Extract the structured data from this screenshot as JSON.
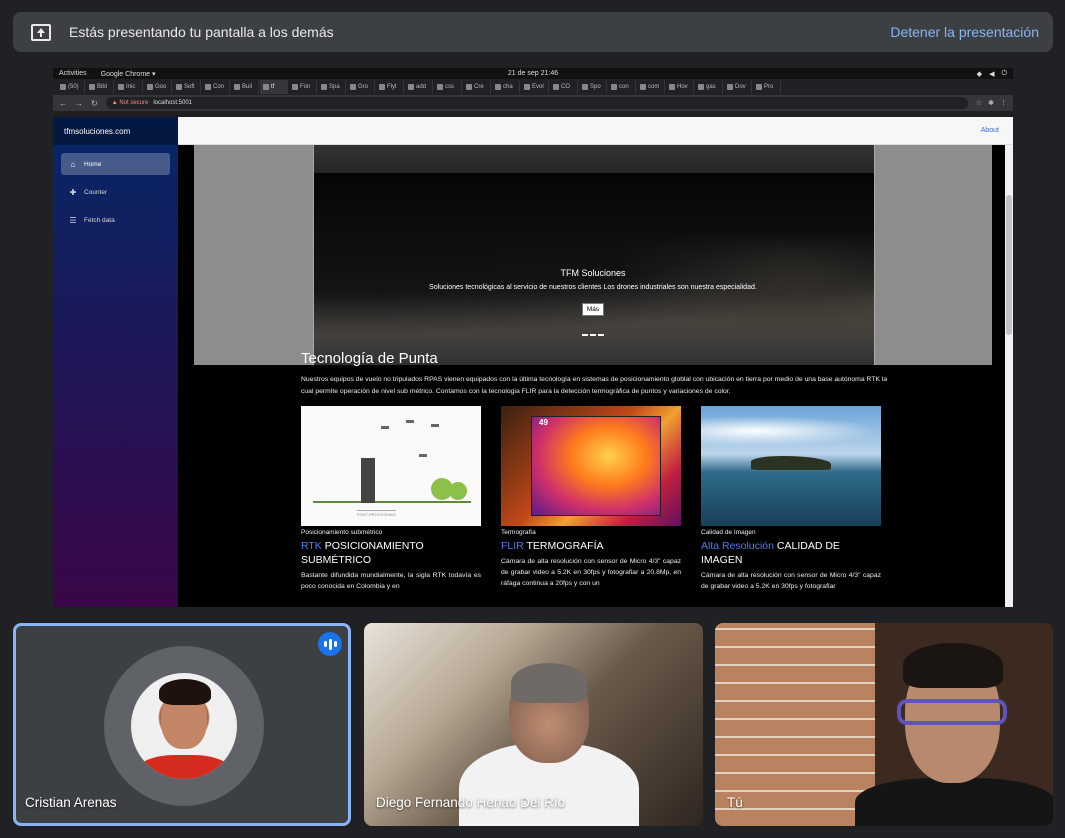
{
  "present_bar": {
    "message": "Estás presentando tu pantalla a los demás",
    "stop_label": "Detener la presentación"
  },
  "desktop": {
    "activities": "Activities",
    "app_menu": "Google Chrome ▾",
    "clock": "21 de sep  21:46"
  },
  "browser": {
    "tabs": [
      {
        "label": "(50)"
      },
      {
        "label": "Bibl"
      },
      {
        "label": "Inic"
      },
      {
        "label": "Goo"
      },
      {
        "label": "Soft"
      },
      {
        "label": "Con"
      },
      {
        "label": "Buil"
      },
      {
        "label": "tf"
      },
      {
        "label": "Fon"
      },
      {
        "label": "Spa"
      },
      {
        "label": "Gro"
      },
      {
        "label": "Flyt"
      },
      {
        "label": "add"
      },
      {
        "label": "css"
      },
      {
        "label": "Cre"
      },
      {
        "label": "cha"
      },
      {
        "label": "Evol"
      },
      {
        "label": "CO"
      },
      {
        "label": "Spo"
      },
      {
        "label": "con"
      },
      {
        "label": "com"
      },
      {
        "label": "Hov"
      },
      {
        "label": "gas"
      },
      {
        "label": "Dov"
      },
      {
        "label": "Pro"
      }
    ],
    "security_label": "Not secure",
    "url": "localhost:5001"
  },
  "site": {
    "brand": "tfmsoluciones.com",
    "nav": [
      {
        "label": "Home",
        "icon": "home-icon"
      },
      {
        "label": "Counter",
        "icon": "plus-icon"
      },
      {
        "label": "Fetch data",
        "icon": "list-icon"
      }
    ],
    "about_link": "About",
    "hero": {
      "title": "TFM Soluciones",
      "subtitle": "Soluciones tecnológicas al servicio de nuestros clientes Los drones industriales son nuestra especialidad.",
      "button": "Más"
    },
    "section": {
      "title": "Tecnología de Punta",
      "intro": "Nuestros equipos de vuelo no tripulados RPAS vienen equipados con la última tecnología en sistemas de posicionamiento globlal con ubicación en tierra por medio de una base autónoma RTK la cual permite operación de nivel sub métrico. Contamos con la tecnologia FLIR para la detección termográfica de puntos y variaciones de color."
    },
    "cards": [
      {
        "category": "Posicionamiento submétrico",
        "highlight": "RTK",
        "title": "POSICIONAMIENTO SUBMÉTRICO",
        "text": "Bastante difundida mundialmente, la sigla RTK todavía es poco conocida en Colombia y en",
        "image_label": "POST-PROCESSING"
      },
      {
        "category": "Termografía",
        "highlight": "FLIR",
        "title": "TERMOGRAFÍA",
        "text": "Cámara de alta resolución con sensor de Micro 4/3\" capaz de grabar video a 5.2K en 30fps y fotografiar a 20.8Mp, en ráfaga continua a 20fps y con un",
        "image_label": "49"
      },
      {
        "category": "Calidad de Imagen",
        "highlight": "Alta Resolución",
        "title": "CALIDAD DE IMAGEN",
        "text": "Cámara de alta resolución con sensor de Micro 4/3\" capaz de grabar video a 5.2K en 30fps y fotografiar"
      }
    ]
  },
  "participants": [
    {
      "name": "Cristian Arenas",
      "speaking": true
    },
    {
      "name": "Diego Fernando Henao Del Río"
    },
    {
      "name": "Tú"
    }
  ],
  "colors": {
    "accent": "#8ab4f8",
    "speaking": "#1a73e8",
    "link": "#4c7cf0"
  }
}
